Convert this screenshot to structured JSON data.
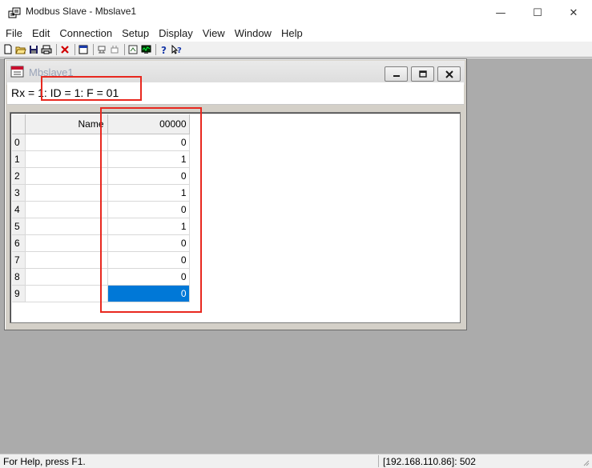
{
  "window": {
    "title": "Modbus Slave - Mbslave1",
    "controls": {
      "minimize": "—",
      "maximize": "☐",
      "close": "✕"
    }
  },
  "menu": [
    "File",
    "Edit",
    "Connection",
    "Setup",
    "Display",
    "View",
    "Window",
    "Help"
  ],
  "toolbar": [
    {
      "icon": "new-document-icon"
    },
    {
      "icon": "open-folder-icon"
    },
    {
      "icon": "save-icon"
    },
    {
      "icon": "print-icon"
    },
    {
      "icon": "separator"
    },
    {
      "icon": "delete-icon"
    },
    {
      "icon": "separator"
    },
    {
      "icon": "window-icon"
    },
    {
      "icon": "separator"
    },
    {
      "icon": "connect-icon"
    },
    {
      "icon": "disconnect-icon"
    },
    {
      "icon": "separator"
    },
    {
      "icon": "setup-icon"
    },
    {
      "icon": "monitor-icon"
    },
    {
      "icon": "separator"
    },
    {
      "icon": "help-icon"
    },
    {
      "icon": "context-help-icon"
    }
  ],
  "child_window": {
    "title": "Mbslave1",
    "status_line": "Rx = 1: ID = 1: F = 01",
    "grid": {
      "name_header": "Name",
      "address_header": "00000",
      "rows": [
        {
          "index": "0",
          "name": "",
          "value": "0"
        },
        {
          "index": "1",
          "name": "",
          "value": "1"
        },
        {
          "index": "2",
          "name": "",
          "value": "0"
        },
        {
          "index": "3",
          "name": "",
          "value": "1"
        },
        {
          "index": "4",
          "name": "",
          "value": "0"
        },
        {
          "index": "5",
          "name": "",
          "value": "1"
        },
        {
          "index": "6",
          "name": "",
          "value": "0"
        },
        {
          "index": "7",
          "name": "",
          "value": "0"
        },
        {
          "index": "8",
          "name": "",
          "value": "0"
        },
        {
          "index": "9",
          "name": "",
          "value": "0"
        }
      ],
      "selected_row": 9
    }
  },
  "statusbar": {
    "help_text": "For Help, press F1.",
    "connection": "[192.168.110.86]: 502"
  },
  "colors": {
    "selection": "#0078d7",
    "annotation": "#e8281f",
    "mdi_background": "#ababab"
  }
}
